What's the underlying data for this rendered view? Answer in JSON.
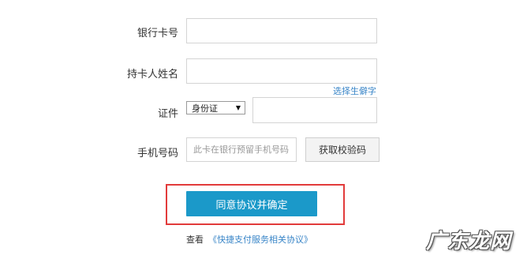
{
  "form": {
    "card_number": {
      "label": "银行卡号",
      "value": "",
      "placeholder": ""
    },
    "holder_name": {
      "label": "持卡人姓名",
      "value": "",
      "placeholder": ""
    },
    "rare_char_link": "选择生僻字",
    "id_doc": {
      "label": "证件",
      "type_selected": "身份证",
      "value": ""
    },
    "phone": {
      "label": "手机号码",
      "placeholder": "此卡在银行预留手机号码"
    },
    "get_code_label": "获取校验码",
    "confirm_label": "同意协议并确定",
    "footer": {
      "view": "查看",
      "agreement_link": "《快捷支付服务相关协议》"
    }
  },
  "watermark": "广东龙网",
  "colors": {
    "accent": "#1b99c9",
    "highlight": "#e23b3b",
    "link": "#3a86c8"
  },
  "icons": {
    "select_arrow": "triangle-down-icon"
  }
}
